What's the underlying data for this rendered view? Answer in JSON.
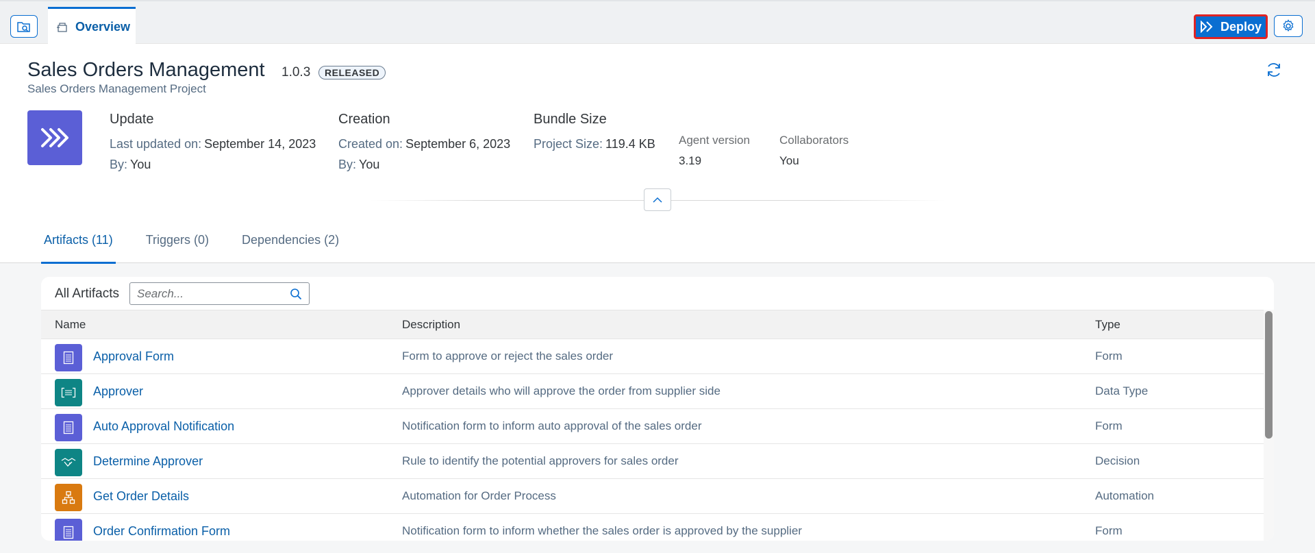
{
  "topbar": {
    "tab_label": "Overview",
    "deploy_label": "Deploy"
  },
  "project": {
    "title": "Sales Orders Management",
    "version": "1.0.3",
    "status": "RELEASED",
    "subtitle": "Sales Orders Management Project",
    "logo_color": "#5b5fd6"
  },
  "update": {
    "heading": "Update",
    "last_updated_label": "Last updated on:",
    "last_updated_value": "September 14, 2023",
    "by_label": "By:",
    "by_value": "You"
  },
  "creation": {
    "heading": "Creation",
    "created_label": "Created on:",
    "created_value": "September 6, 2023",
    "by_label": "By:",
    "by_value": "You"
  },
  "bundle": {
    "heading": "Bundle Size",
    "size_label": "Project Size:",
    "size_value": "119.4 KB"
  },
  "agent": {
    "label": "Agent version",
    "value": "3.19"
  },
  "collaborators": {
    "label": "Collaborators",
    "value": "You"
  },
  "tabs": [
    {
      "label": "Artifacts (11)",
      "active": true
    },
    {
      "label": "Triggers (0)",
      "active": false
    },
    {
      "label": "Dependencies (2)",
      "active": false
    }
  ],
  "artifacts": {
    "title": "All Artifacts",
    "search_placeholder": "Search...",
    "columns": {
      "name": "Name",
      "description": "Description",
      "type": "Type"
    },
    "rows": [
      {
        "name": "Approval Form",
        "description": "Form to approve or reject the sales order",
        "type": "Form",
        "icon": "form-icon",
        "color": "#5b5fd6"
      },
      {
        "name": "Approver",
        "description": "Approver details who will approve the order from supplier side",
        "type": "Data Type",
        "icon": "data-type-icon",
        "color": "#0e8585"
      },
      {
        "name": "Auto Approval Notification",
        "description": "Notification form to inform auto approval of the sales order",
        "type": "Form",
        "icon": "form-icon",
        "color": "#5b5fd6"
      },
      {
        "name": "Determine Approver",
        "description": "Rule to identify the potential approvers for sales order",
        "type": "Decision",
        "icon": "decision-icon",
        "color": "#0e8585"
      },
      {
        "name": "Get Order Details",
        "description": "Automation for Order Process",
        "type": "Automation",
        "icon": "automation-icon",
        "color": "#d97a10"
      },
      {
        "name": "Order Confirmation Form",
        "description": "Notification form to inform whether the sales order is approved by the supplier",
        "type": "Form",
        "icon": "form-icon",
        "color": "#5b5fd6"
      }
    ]
  }
}
